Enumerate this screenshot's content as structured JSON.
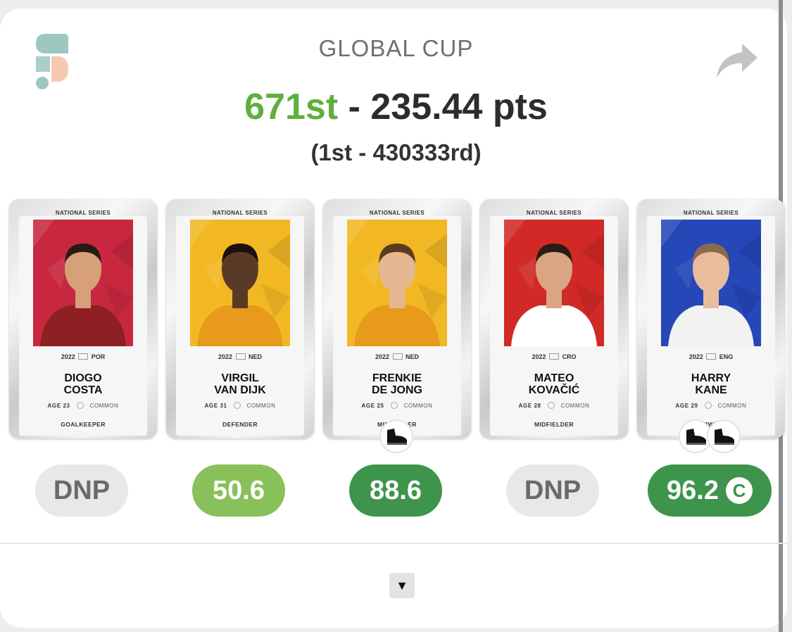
{
  "header": {
    "logo_icon": "sorare-logo-icon",
    "share_icon": "share-arrow-icon",
    "title": "GLOBAL CUP",
    "rank": "671st",
    "separator": " - ",
    "points": "235.44 pts",
    "rank_range": "(1st - 430333rd)"
  },
  "cards": [
    {
      "series": "NATIONAL SERIES",
      "year": "2022",
      "country": "POR",
      "name_line1": "DIOGO",
      "name_line2": "COSTA",
      "age": "AGE 23",
      "rarity": "COMMON",
      "position": "GOALKEEPER",
      "bg_color": "#c8283f",
      "jersey_color": "#8e1f22",
      "skin": "#d6a07a",
      "hair": "#2a1a12"
    },
    {
      "series": "NATIONAL SERIES",
      "year": "2022",
      "country": "NED",
      "name_line1": "VIRGIL",
      "name_line2": "VAN DIJK",
      "age": "AGE 31",
      "rarity": "COMMON",
      "position": "DEFENDER",
      "bg_color": "#f2b824",
      "jersey_color": "#e79a1c",
      "skin": "#5a3a26",
      "hair": "#1b120d"
    },
    {
      "series": "NATIONAL SERIES",
      "year": "2022",
      "country": "NED",
      "name_line1": "FRENKIE",
      "name_line2": "DE JONG",
      "age": "AGE 25",
      "rarity": "COMMON",
      "position": "MIDFIELDER",
      "bg_color": "#f2b824",
      "jersey_color": "#e79a1c",
      "skin": "#e7b791",
      "hair": "#5b3a22"
    },
    {
      "series": "NATIONAL SERIES",
      "year": "2022",
      "country": "CRO",
      "name_line1": "MATEO",
      "name_line2": "KOVAČIĆ",
      "age": "AGE 28",
      "rarity": "COMMON",
      "position": "MIDFIELDER",
      "bg_color": "#d12a26",
      "jersey_color": "#ffffff",
      "skin": "#d9a583",
      "hair": "#2a1c14"
    },
    {
      "series": "NATIONAL SERIES",
      "year": "2022",
      "country": "ENG",
      "name_line1": "HARRY",
      "name_line2": "KANE",
      "age": "AGE 29",
      "rarity": "COMMON",
      "position": "FORWARD",
      "bg_color": "#2547b7",
      "jersey_color": "#f2f2f2",
      "skin": "#e9bc9c",
      "hair": "#8a6a4a"
    }
  ],
  "scores": [
    {
      "value": "DNP",
      "style": "dnp"
    },
    {
      "value": "50.6",
      "style": "light"
    },
    {
      "value": "88.6",
      "style": "dark"
    },
    {
      "value": "DNP",
      "style": "dnp"
    },
    {
      "value": "96.2",
      "style": "dark",
      "captain_badge": "C"
    }
  ],
  "badges": {
    "boot_icon": "football-boot-icon",
    "captain_icon": "captain-badge-icon"
  },
  "expand_icon": "triangle-down-icon",
  "expand_glyph": "▼",
  "colors": {
    "rank_green": "#5fae3e",
    "score_light_green": "#88c05a",
    "score_dark_green": "#3e944b",
    "dnp_gray": "#e8e8e8"
  }
}
